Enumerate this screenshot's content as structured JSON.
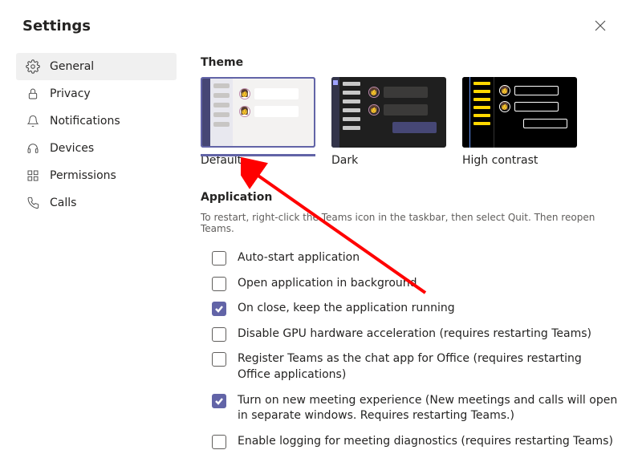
{
  "header": {
    "title": "Settings"
  },
  "sidebar": {
    "items": [
      {
        "icon": "gear-icon",
        "label": "General",
        "active": true
      },
      {
        "icon": "lock-icon",
        "label": "Privacy"
      },
      {
        "icon": "bell-icon",
        "label": "Notifications"
      },
      {
        "icon": "headset-icon",
        "label": "Devices"
      },
      {
        "icon": "grid-icon",
        "label": "Permissions"
      },
      {
        "icon": "phone-icon",
        "label": "Calls"
      }
    ]
  },
  "theme": {
    "heading": "Theme",
    "options": [
      {
        "label": "Default",
        "selected": true
      },
      {
        "label": "Dark"
      },
      {
        "label": "High contrast"
      }
    ]
  },
  "application": {
    "heading": "Application",
    "subtext": "To restart, right-click the Teams icon in the taskbar, then select Quit. Then reopen Teams.",
    "options": [
      {
        "label": "Auto-start application",
        "checked": false
      },
      {
        "label": "Open application in background",
        "checked": false
      },
      {
        "label": "On close, keep the application running",
        "checked": true
      },
      {
        "label": "Disable GPU hardware acceleration (requires restarting Teams)",
        "checked": false
      },
      {
        "label": "Register Teams as the chat app for Office (requires restarting Office applications)",
        "checked": false
      },
      {
        "label": "Turn on new meeting experience (New meetings and calls will open in separate windows. Requires restarting Teams.)",
        "checked": true
      },
      {
        "label": "Enable logging for meeting diagnostics (requires restarting Teams)",
        "checked": false
      }
    ]
  }
}
